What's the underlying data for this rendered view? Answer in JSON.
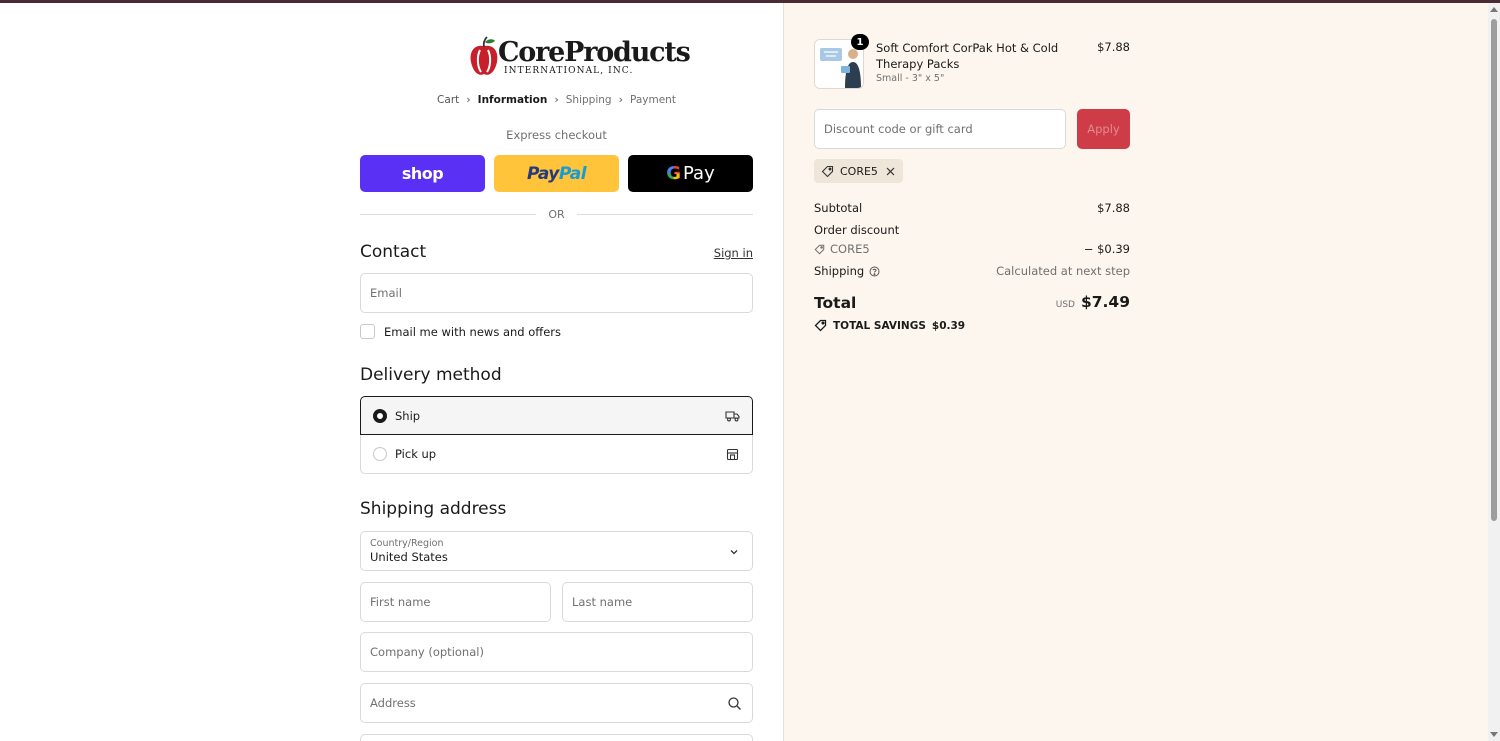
{
  "brand": {
    "name_main": "CoreProducts",
    "name_sub": "INTERNATIONAL, INC."
  },
  "breadcrumb": [
    {
      "label": "Cart"
    },
    {
      "label": "Information"
    },
    {
      "label": "Shipping"
    },
    {
      "label": "Payment"
    }
  ],
  "express": {
    "title": "Express checkout",
    "shop_label": "shop",
    "paypal_label_a": "Pay",
    "paypal_label_b": "Pal",
    "gpay_g": "G",
    "gpay_label": "Pay"
  },
  "divider_or": "OR",
  "contact": {
    "heading": "Contact",
    "sign_in": "Sign in",
    "email_placeholder": "Email",
    "news_label": "Email me with news and offers"
  },
  "delivery": {
    "heading": "Delivery method",
    "options": [
      {
        "label": "Ship",
        "selected": true,
        "icon": "truck-icon"
      },
      {
        "label": "Pick up",
        "selected": false,
        "icon": "store-icon"
      }
    ]
  },
  "shipping_address": {
    "heading": "Shipping address",
    "country_label": "Country/Region",
    "country_value": "United States",
    "first_name": "First name",
    "last_name": "Last name",
    "company": "Company (optional)",
    "address": "Address"
  },
  "cart": {
    "item": {
      "quantity": "1",
      "name": "Soft Comfort CorPak Hot & Cold Therapy Packs",
      "variant": "Small - 3\" x 5\"",
      "price": "$7.88"
    },
    "discount_placeholder": "Discount code or gift card",
    "apply_label": "Apply",
    "applied_code": "CORE5"
  },
  "summary": {
    "subtotal_label": "Subtotal",
    "subtotal_value": "$7.88",
    "order_discount_label": "Order discount",
    "code_label": "CORE5",
    "code_value": "− $0.39",
    "shipping_label": "Shipping",
    "shipping_value": "Calculated at next step",
    "total_label": "Total",
    "currency": "USD",
    "total_value": "$7.49",
    "savings_label": "TOTAL SAVINGS",
    "savings_value": "$0.39"
  },
  "colors": {
    "accent_shop": "#5a31f4",
    "paypal_yellow": "#ffc439",
    "apply_red": "#cd3c47",
    "summary_bg": "#fdf6ee"
  }
}
